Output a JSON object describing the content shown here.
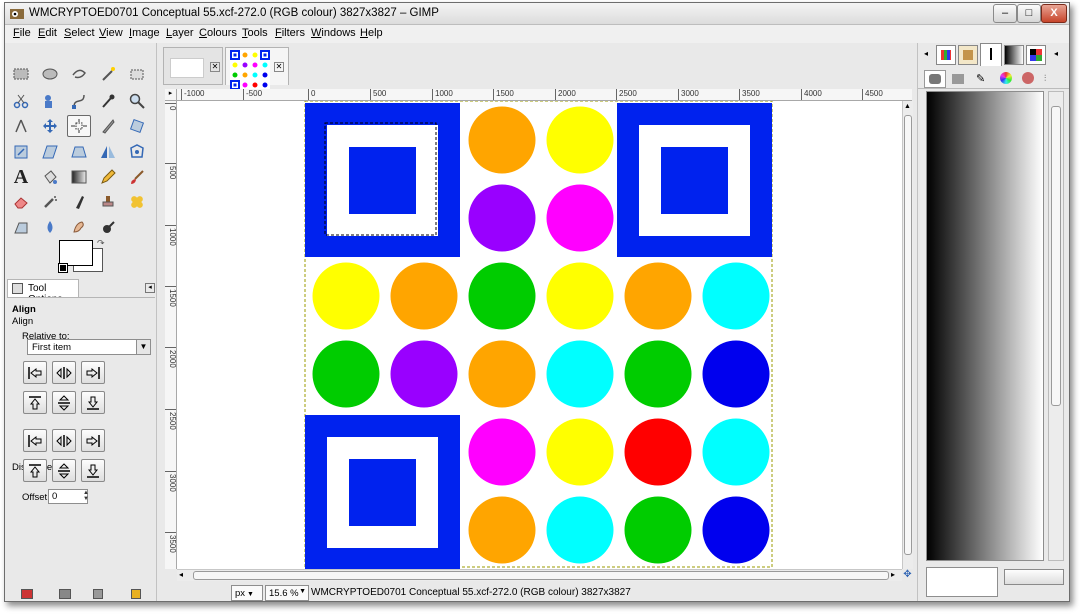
{
  "window": {
    "title": "WMCRYPTOED0701 Conceptual 55.xcf-272.0 (RGB colour) 3827x3827 – GIMP"
  },
  "window_controls": {
    "minimize": "–",
    "maximize": "□",
    "close": "X"
  },
  "menu": [
    "File",
    "Edit",
    "Select",
    "View",
    "Image",
    "Layer",
    "Colours",
    "Tools",
    "Filters",
    "Windows",
    "Help"
  ],
  "tool_options": {
    "tab_label": "Tool Options",
    "tool_name": "Align",
    "section_title": "Align",
    "relative_to_label": "Relative to:",
    "relative_to_value": "First item",
    "distribute_label": "Distribute",
    "offset_label": "Offset:",
    "offset_value": "0"
  },
  "ruler_h": [
    "-1000",
    "-500",
    "0",
    "500",
    "1000",
    "1500",
    "2000",
    "2500",
    "3000",
    "3500",
    "4000",
    "4500"
  ],
  "ruler_v": [
    "0",
    "500",
    "1000",
    "1500",
    "2000",
    "2500",
    "3000",
    "3500"
  ],
  "status": {
    "unit": "px",
    "zoom": "15.6 %",
    "message": "WMCRYPTOED0701 Conceptual 55.xcf-272.0 (RGB colour) 3827x3827"
  },
  "image_content": {
    "colors": {
      "blue": "#0022ee",
      "white": "#ffffff",
      "orange": "#ffa500",
      "yellow": "#ffff00",
      "purple": "#9900ff",
      "magenta": "#ff00ff",
      "green": "#00cc00",
      "cyan": "#00ffff",
      "dark_blue": "#0000ee",
      "red": "#ff0000"
    },
    "circle_rows": [
      [
        "",
        "",
        "orange",
        "yellow",
        "",
        ""
      ],
      [
        "",
        "",
        "purple",
        "magenta",
        "",
        ""
      ],
      [
        "yellow",
        "orange",
        "green",
        "yellow",
        "orange",
        "cyan"
      ],
      [
        "green",
        "purple",
        "orange",
        "cyan",
        "green",
        "dark_blue"
      ],
      [
        "",
        "",
        "magenta",
        "yellow",
        "red",
        "cyan"
      ],
      [
        "",
        "",
        "orange",
        "cyan",
        "green",
        "dark_blue"
      ]
    ]
  }
}
